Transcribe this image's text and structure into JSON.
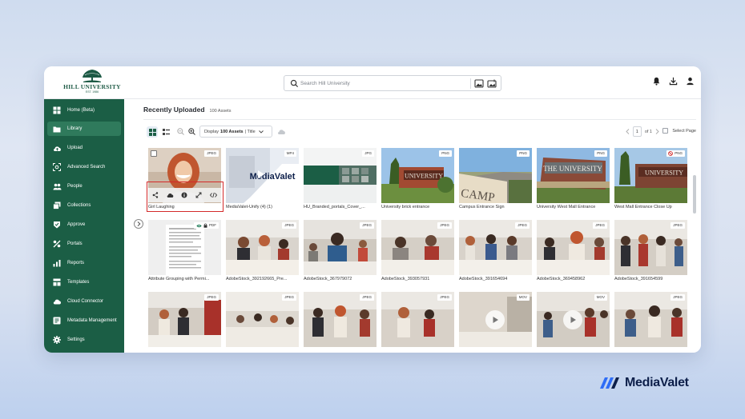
{
  "app": {
    "org_name": "HILL UNIVERSITY",
    "org_est": "EST. 1986",
    "brand": "MediaValet"
  },
  "search": {
    "placeholder": "Search Hill University"
  },
  "topbar": {
    "icons": [
      "bell-icon",
      "download-icon",
      "user-icon"
    ]
  },
  "sidebar": {
    "items": [
      {
        "label": "Home (Beta)",
        "icon": "grid-icon",
        "active": false
      },
      {
        "label": "Library",
        "icon": "folder-icon",
        "active": true
      },
      {
        "label": "Upload",
        "icon": "cloud-upload-icon",
        "active": false
      },
      {
        "label": "Advanced Search",
        "icon": "search-frame-icon",
        "active": false
      },
      {
        "label": "People",
        "icon": "people-icon",
        "active": false
      },
      {
        "label": "Collections",
        "icon": "collections-icon",
        "active": false
      },
      {
        "label": "Approve",
        "icon": "approve-icon",
        "active": false
      },
      {
        "label": "Portals",
        "icon": "portal-icon",
        "active": false
      },
      {
        "label": "Reports",
        "icon": "chart-icon",
        "active": false
      },
      {
        "label": "Templates",
        "icon": "template-icon",
        "active": false
      },
      {
        "label": "Cloud Connector",
        "icon": "cloud-icon",
        "active": false
      },
      {
        "label": "Metadata Management",
        "icon": "metadata-icon",
        "active": false
      },
      {
        "label": "Settings",
        "icon": "gear-icon",
        "active": false
      }
    ]
  },
  "main": {
    "title": "Recently Uploaded",
    "count": "100 Assets",
    "display": {
      "prefix": "Display",
      "value": "100 Assets",
      "sort": "| Title"
    },
    "pager": {
      "page": "1",
      "of_label": "of 1"
    },
    "select_page_label": "Select Page"
  },
  "assets": [
    {
      "name": "Girl Laughing",
      "type": "JPEG"
    },
    {
      "name": "MediaValet-Unify (4) (1)",
      "type": "MP4"
    },
    {
      "name": "HU_Branded_portals_Cover_...",
      "type": "JPG"
    },
    {
      "name": "University brick entrance",
      "type": "PNG"
    },
    {
      "name": "Campus Entrance Sign",
      "type": "PNG"
    },
    {
      "name": "University West Mall Entrance",
      "type": "PNG"
    },
    {
      "name": "West Mall Entrance Close Up",
      "type": "PNG"
    },
    {
      "name": "Attribute Grouping with Permi...",
      "type": "PDF"
    },
    {
      "name": "AdobeStock_392192665_Pre...",
      "type": "JPEG"
    },
    {
      "name": "AdobeStock_367979072",
      "type": "JPEG"
    },
    {
      "name": "AdobeStock_393057931",
      "type": "JPEG"
    },
    {
      "name": "AdobeStock_391654694",
      "type": "JPEG"
    },
    {
      "name": "AdobeStock_369458962",
      "type": "JPEG"
    },
    {
      "name": "AdobeStock_391654599",
      "type": "JPEG"
    },
    {
      "name": "",
      "type": "JPEG"
    },
    {
      "name": "",
      "type": "JPEG"
    },
    {
      "name": "",
      "type": "JPEG"
    },
    {
      "name": "",
      "type": "JPEG"
    },
    {
      "name": "",
      "type": "MOV"
    },
    {
      "name": "",
      "type": "MOV"
    },
    {
      "name": "",
      "type": "JPEG"
    }
  ],
  "thumb_text": {
    "mediavalet": "MediaValet",
    "university": "UNIVERSITY",
    "the_university": "THE UNIVERSITY",
    "campus": "CAMP"
  },
  "colors": {
    "sidebar": "#1b5e45",
    "sidebar_active": "#2f7a5c",
    "highlight": "#d42a2a",
    "brand_navy": "#0d1f4a",
    "brand_blue": "#2f6df6"
  }
}
